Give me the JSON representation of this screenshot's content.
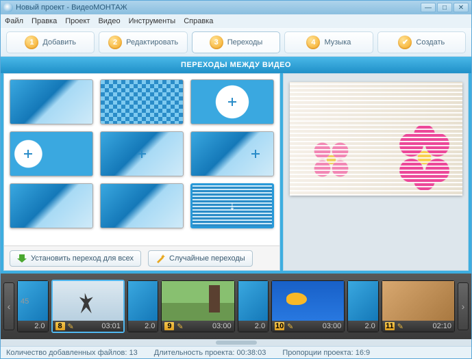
{
  "window": {
    "title": "Новый проект - ВидеоМОНТАЖ"
  },
  "menu": {
    "file": "Файл",
    "edit": "Правка",
    "project": "Проект",
    "video": "Видео",
    "tools": "Инструменты",
    "help": "Справка"
  },
  "tabs": {
    "add": {
      "num": "1",
      "label": "Добавить"
    },
    "editTab": {
      "num": "2",
      "label": "Редактировать"
    },
    "transitions": {
      "num": "3",
      "label": "Переходы"
    },
    "music": {
      "num": "4",
      "label": "Музыка"
    },
    "create": {
      "num": "✔",
      "label": "Создать"
    }
  },
  "banner": "ПЕРЕХОДЫ МЕЖДУ ВИДЕО",
  "buttons": {
    "apply_all": "Установить переход для всех",
    "random": "Случайные переходы"
  },
  "timeline": {
    "t1": {
      "dur": "2.0",
      "idx": "45"
    },
    "c8": {
      "num": "8",
      "dur": "03:01"
    },
    "t2": {
      "dur": "2.0"
    },
    "c9": {
      "num": "9",
      "dur": "03:00"
    },
    "t3": {
      "dur": "2.0"
    },
    "c10": {
      "num": "10",
      "dur": "03:00"
    },
    "t4": {
      "dur": "2.0"
    },
    "c11": {
      "num": "11",
      "dur": "02:10"
    }
  },
  "status": {
    "files_label": "Количество добавленных файлов:",
    "files_val": "13",
    "dur_label": "Длительность проекта:",
    "dur_val": "00:38:03",
    "ratio_label": "Пропорции проекта:",
    "ratio_val": "16:9"
  }
}
